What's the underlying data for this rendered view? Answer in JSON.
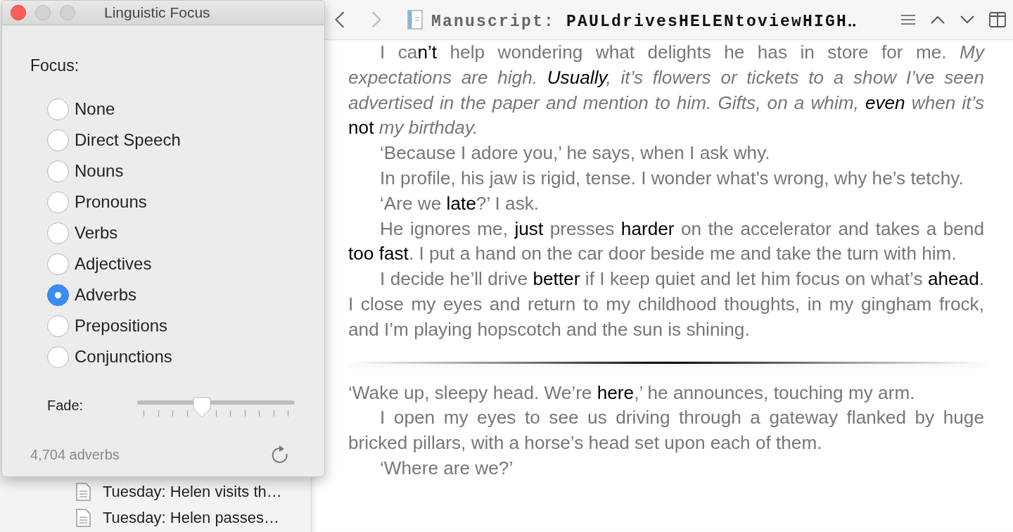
{
  "panel": {
    "title": "Linguistic Focus",
    "focus_label": "Focus:",
    "options": [
      {
        "label": "None",
        "selected": false
      },
      {
        "label": "Direct Speech",
        "selected": false
      },
      {
        "label": "Nouns",
        "selected": false
      },
      {
        "label": "Pronouns",
        "selected": false
      },
      {
        "label": "Verbs",
        "selected": false
      },
      {
        "label": "Adjectives",
        "selected": false
      },
      {
        "label": "Adverbs",
        "selected": true
      },
      {
        "label": "Prepositions",
        "selected": false
      },
      {
        "label": "Conjunctions",
        "selected": false
      }
    ],
    "fade": {
      "label": "Fade:",
      "level": 0.41
    },
    "count": "4,704 adverbs"
  },
  "sidebar": {
    "items": [
      {
        "text": "Tuesday: Helen visits th…"
      },
      {
        "text": "Tuesday: Helen passes…"
      }
    ]
  },
  "header": {
    "nav": [
      {
        "kind": "back",
        "disabled": false
      },
      {
        "kind": "forward",
        "disabled": true
      }
    ],
    "title_prefix": "Manuscript:",
    "title": "PAULdrivesHELENtoviewHIGH‥"
  },
  "sections": [
    {
      "paragraphs": [
        {
          "indent": true,
          "segments": [
            {
              "kind": "plain",
              "text": "I ca"
            },
            {
              "kind": "highlighted",
              "text": "n’t"
            },
            {
              "kind": "plain",
              "text": " help wondering what delights he has in store for me. "
            },
            {
              "kind": "italic",
              "text": "My expectations are high. "
            },
            {
              "kind": "highlighted_italic",
              "text": "Usually"
            },
            {
              "kind": "italic",
              "text": ", it’s flowers or tickets to a show I’ve seen advertised in the paper and mention to him. Gifts, on a whim, "
            },
            {
              "kind": "highlighted_italic",
              "text": "even"
            },
            {
              "kind": "italic",
              "text": " when it’s "
            },
            {
              "kind": "highlighted",
              "text": "not"
            },
            {
              "kind": "italic",
              "text": " my birthday."
            }
          ]
        },
        {
          "indent": true,
          "segments": [
            {
              "kind": "plain",
              "text": "‘Because I adore you,’ he says, when I ask why."
            }
          ]
        },
        {
          "indent": true,
          "segments": [
            {
              "kind": "plain",
              "text": "In profile, his jaw is rigid, tense. I wonder what’s wrong, why he’s tetchy."
            }
          ]
        },
        {
          "indent": true,
          "segments": [
            {
              "kind": "plain",
              "text": "‘Are we "
            },
            {
              "kind": "highlighted",
              "text": "late"
            },
            {
              "kind": "plain",
              "text": "?’ I ask."
            }
          ]
        },
        {
          "indent": true,
          "segments": [
            {
              "kind": "plain",
              "text": "He ignores me, "
            },
            {
              "kind": "highlighted",
              "text": "just"
            },
            {
              "kind": "plain",
              "text": " presses "
            },
            {
              "kind": "highlighted",
              "text": "harder"
            },
            {
              "kind": "plain",
              "text": " on the accelerator and takes a bend "
            },
            {
              "kind": "highlighted",
              "text": "too fast"
            },
            {
              "kind": "plain",
              "text": ". I put a hand on the car door beside me and take the turn with him."
            }
          ]
        },
        {
          "indent": true,
          "segments": [
            {
              "kind": "plain",
              "text": "I decide he’ll drive "
            },
            {
              "kind": "highlighted",
              "text": "better"
            },
            {
              "kind": "plain",
              "text": " if I keep quiet and let him focus on what’s "
            },
            {
              "kind": "highlighted",
              "text": "ahead"
            },
            {
              "kind": "plain",
              "text": ". I close my eyes and return to my childhood thoughts, in my gingham frock, and I’m playing hopscotch and the sun is shining."
            }
          ]
        }
      ]
    },
    {
      "paragraphs": [
        {
          "indent": false,
          "segments": [
            {
              "kind": "plain",
              "text": "‘Wake up, sleepy head. We’re "
            },
            {
              "kind": "highlighted",
              "text": "here"
            },
            {
              "kind": "plain",
              "text": ",’ he announces, touching my arm."
            }
          ]
        },
        {
          "indent": true,
          "segments": [
            {
              "kind": "plain",
              "text": "I open my eyes to see us driving through a gateway flanked by huge bricked pillars, with a horse’s head set upon each of them."
            }
          ]
        },
        {
          "indent": true,
          "segments": [
            {
              "kind": "plain",
              "text": "‘Where are we?’"
            }
          ]
        }
      ]
    }
  ]
}
